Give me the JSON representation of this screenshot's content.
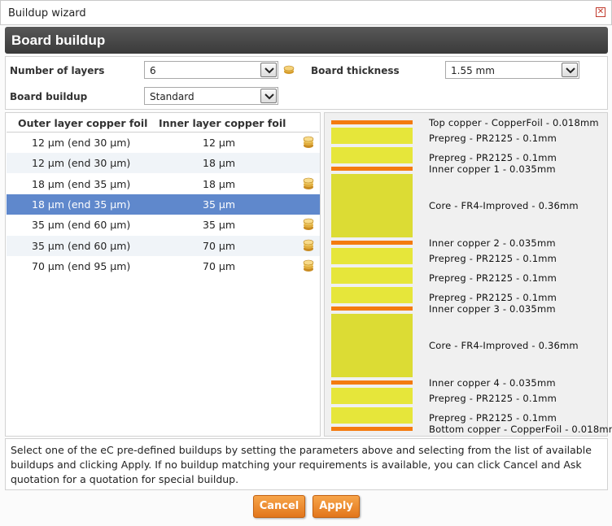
{
  "window": {
    "title": "Buildup wizard"
  },
  "header": {
    "title": "Board buildup"
  },
  "params": {
    "layers_label": "Number of layers",
    "layers_value": "6",
    "thickness_label": "Board thickness",
    "thickness_value": "1.55 mm",
    "buildup_label": "Board buildup",
    "buildup_value": "Standard"
  },
  "foil_table": {
    "headers": [
      "Outer layer copper foil",
      "Inner layer copper foil"
    ],
    "rows": [
      {
        "outer": "12 µm (end 30 µm)",
        "inner": "12 µm",
        "quote_icon": true,
        "selected": false
      },
      {
        "outer": "12 µm (end 30 µm)",
        "inner": "18 µm",
        "quote_icon": false,
        "selected": false
      },
      {
        "outer": "18 µm (end 35 µm)",
        "inner": "18 µm",
        "quote_icon": true,
        "selected": false
      },
      {
        "outer": "18 µm (end 35 µm)",
        "inner": "35 µm",
        "quote_icon": false,
        "selected": true
      },
      {
        "outer": "35 µm (end 60 µm)",
        "inner": "35 µm",
        "quote_icon": true,
        "selected": false
      },
      {
        "outer": "35 µm (end 60 µm)",
        "inner": "70 µm",
        "quote_icon": true,
        "selected": false
      },
      {
        "outer": "70 µm (end 95 µm)",
        "inner": "70 µm",
        "quote_icon": true,
        "selected": false
      }
    ]
  },
  "stackup": {
    "layers": [
      {
        "kind": "copper",
        "label": "Top copper - CopperFoil - 0.018mm"
      },
      {
        "kind": "prepreg",
        "label": "Prepreg - PR2125 - 0.1mm"
      },
      {
        "kind": "prepreg",
        "label": "Prepreg - PR2125 - 0.1mm"
      },
      {
        "kind": "copper",
        "label": "Inner copper 1 - 0.035mm"
      },
      {
        "kind": "core",
        "label": "Core - FR4-Improved - 0.36mm"
      },
      {
        "kind": "copper",
        "label": "Inner copper 2 - 0.035mm"
      },
      {
        "kind": "prepreg",
        "label": "Prepreg - PR2125 - 0.1mm"
      },
      {
        "kind": "prepreg",
        "label": "Prepreg - PR2125 - 0.1mm"
      },
      {
        "kind": "prepreg",
        "label": "Prepreg - PR2125 - 0.1mm"
      },
      {
        "kind": "copper",
        "label": "Inner copper 3 - 0.035mm"
      },
      {
        "kind": "core",
        "label": "Core - FR4-Improved - 0.36mm"
      },
      {
        "kind": "copper",
        "label": "Inner copper 4 - 0.035mm"
      },
      {
        "kind": "prepreg",
        "label": "Prepreg - PR2125 - 0.1mm"
      },
      {
        "kind": "prepreg",
        "label": "Prepreg - PR2125 - 0.1mm"
      },
      {
        "kind": "copper",
        "label": "Bottom copper - CopperFoil - 0.018mm"
      }
    ],
    "colors": {
      "copper": "#f47b10",
      "prepreg": "#e6e63a",
      "core": "#dcdc34"
    }
  },
  "info_text": "Select one of the eC pre-defined buildups by setting the parameters above and selecting from the list of available buildups and clicking Apply. If no buildup matching your requirements is available, you can click Cancel and Ask quotation for a quotation for special buildup.",
  "buttons": {
    "cancel": "Cancel",
    "apply": "Apply"
  },
  "icons": {
    "quote": "coin-stack-icon",
    "close": "close-icon"
  }
}
